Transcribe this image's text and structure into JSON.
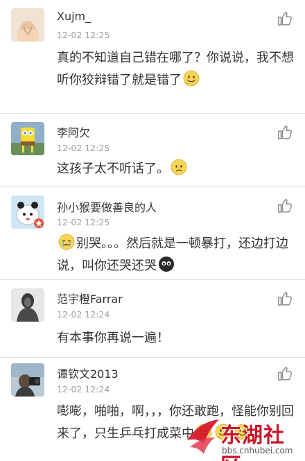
{
  "comments": [
    {
      "name": "Xujm_",
      "time": "12-02 12:25",
      "text": "真的不知道自己错在哪了？你说说，我不想听你狡辩错了就是错了",
      "emojis_after": [
        "smile-emoji"
      ]
    },
    {
      "name": "李阿欠",
      "time": "12-02 12:25",
      "text": "这孩子太不听话了。",
      "emojis_after": [
        "sad-emoji"
      ]
    },
    {
      "name": "孙小猴要做善良的人",
      "time": "12-02 12:25",
      "text_emoji_before": "cry-emoji",
      "text": "别哭。。。然后就是一顿暴打，还边打边说，叫你还哭还哭",
      "emojis_after": [
        "dark-face-emoji"
      ]
    },
    {
      "name": "范宇橙Farrar",
      "time": "12-02 12:24",
      "text": "有本事你再说一遍！",
      "emojis_after": []
    },
    {
      "name": "谭钦文2013",
      "time": "12-02 12:24",
      "text": "嘭嘭，啪啪，啊，，，你还敢跑，怪能你别回来了，只生乒乓打成菜中",
      "emojis_after": [
        "smile-emoji",
        "smile-emoji",
        "smile-emoji"
      ]
    }
  ],
  "watermark": {
    "title": "东湖社区",
    "url": "bbs.cnhubei.com"
  },
  "colors": {
    "text": "#333333",
    "time": "#a0a0a0",
    "divider": "#dcdcdc",
    "brand": "#c8152b"
  }
}
